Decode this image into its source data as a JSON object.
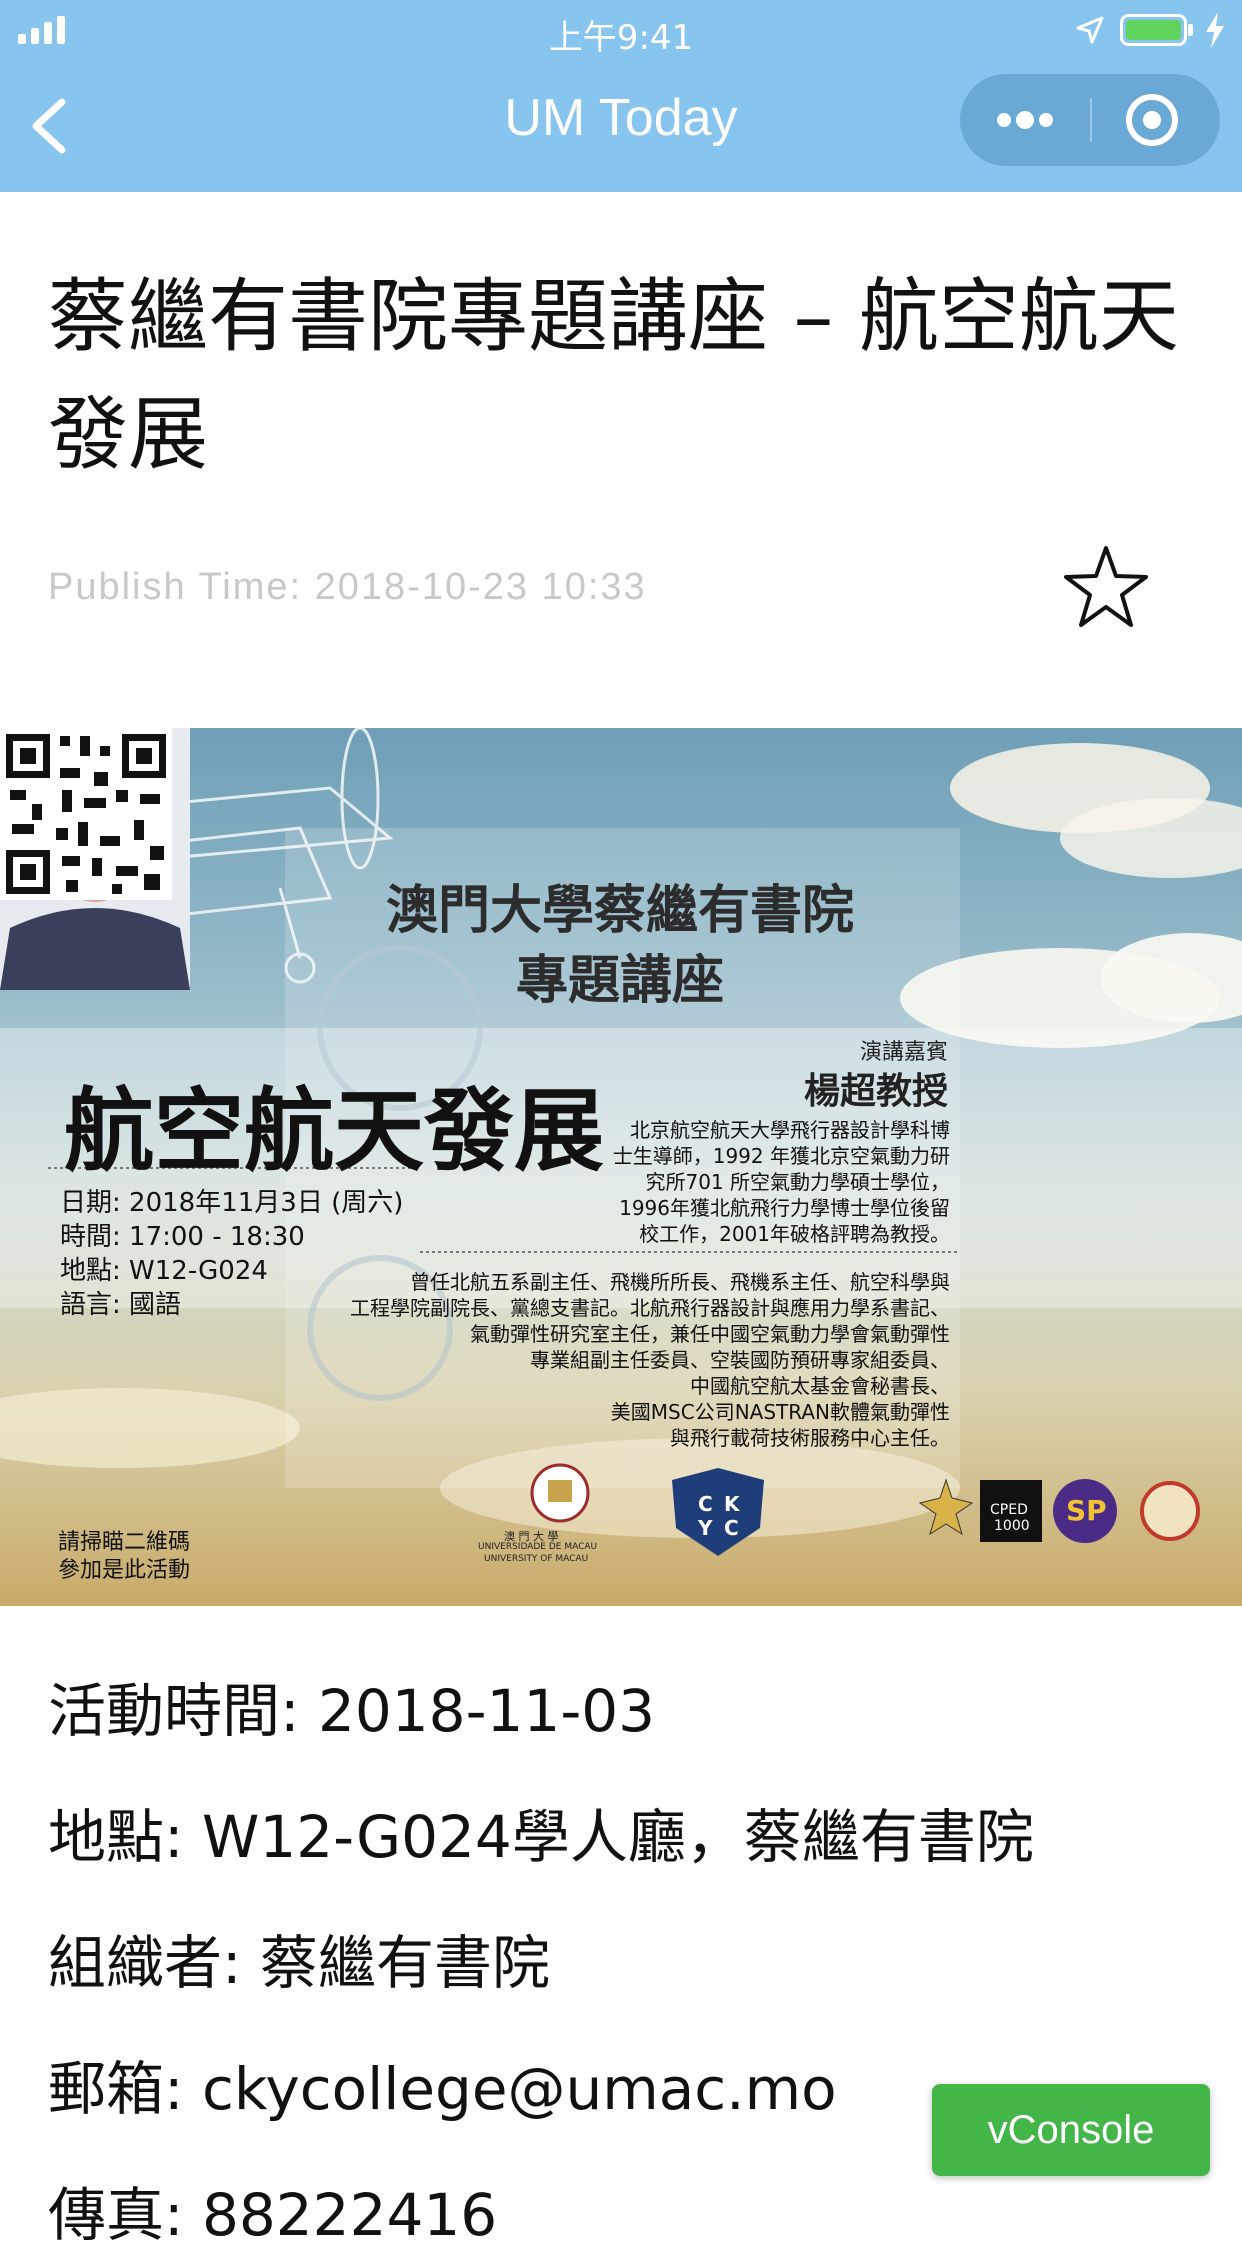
{
  "status_bar": {
    "time": "上午9:41"
  },
  "nav": {
    "title": "UM Today",
    "icons": {
      "back": "chevron-left-icon",
      "more": "more-dots-icon",
      "close": "target-circle-icon"
    }
  },
  "article": {
    "title": "蔡繼有書院專題講座 – 航空航天發展",
    "publish_time": "Publish Time: 2018-10-23 10:33",
    "favorite_icon": "star-outline-icon"
  },
  "poster": {
    "heading_line1": "澳門大學蔡繼有書院",
    "heading_line2": "專題講座",
    "topic": "航空航天發展",
    "info": [
      "日期: 2018年11月3日 (周六)",
      "時間: 17:00 - 18:30",
      "地點: W12-G024",
      "語言: 國語"
    ],
    "speaker_label": "演講嘉賓",
    "speaker_name": "楊超教授",
    "bio_top": [
      "北京航空航天大學飛行器設計學科博",
      "士生導師，1992 年獲北京空氣動力研",
      "究所701 所空氣動力學碩士學位，",
      "1996年獲北航飛行力學博士學位後留",
      "校工作，2001年破格評聘為教授。"
    ],
    "bio_bottom": [
      "曾任北航五系副主任、飛機所所長、飛機系主任、航空科學與",
      "工程學院副院長、黨總支書記。北航飛行器設計與應用力學系書記、",
      "氣動彈性研究室主任，兼任中國空氣動力學會氣動彈性",
      "專業組副主任委員、空裝國防預研專家組委員、",
      "中國航空航太基金會秘書長、",
      "美國MSC公司NASTRAN軟體氣動彈性",
      "與飛行載荷技術服務中心主任。"
    ],
    "qr_caption": [
      "請掃瞄二維碼",
      "參加是此活動"
    ],
    "logo_um": [
      "澳 門 大 學",
      "UNIVERSIDADE DE MACAU",
      "UNIVERSITY OF MACAU"
    ],
    "logo_ckyc": [
      "C",
      "K",
      "Y",
      "C"
    ],
    "logo_cped": [
      "CPED",
      "1000"
    ],
    "logo_sp": "SP"
  },
  "details": [
    "活動時間: 2018-11-03",
    "地點: W12-G024學人廳，蔡繼有書院",
    "組織者: 蔡繼有書院",
    "郵箱: ckycollege@umac.mo",
    "傳真: 88222416"
  ],
  "vconsole": "vConsole"
}
